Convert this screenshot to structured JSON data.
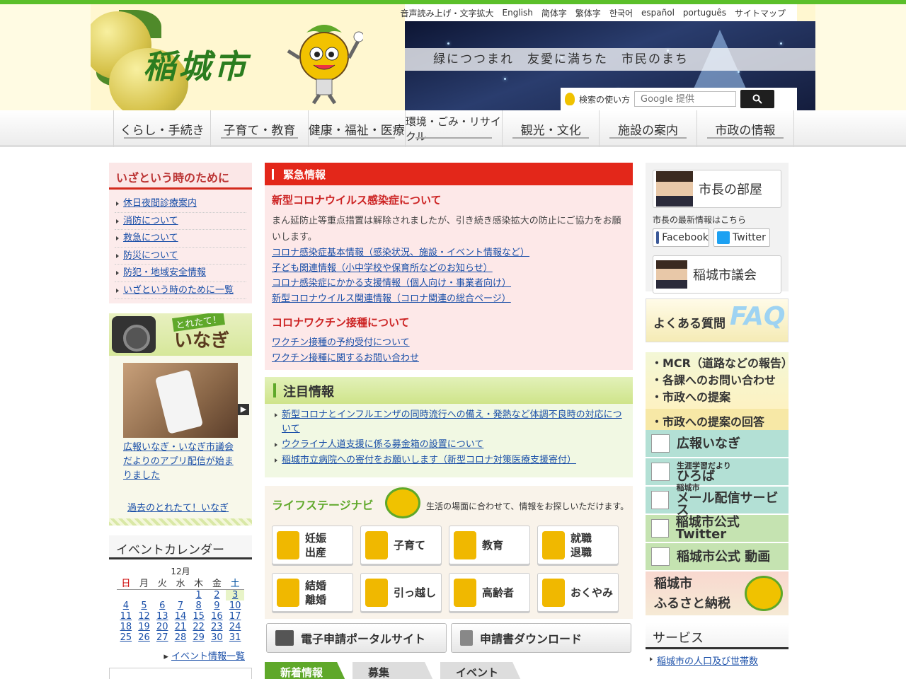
{
  "header": {
    "city_logo": "稲城市",
    "slogan": "緑につつまれ　友愛に満ちた　市民のまち",
    "lang_links": [
      "音声読み上げ・文字拡大",
      "English",
      "简体字",
      "繁体字",
      "한국어",
      "español",
      "português",
      "サイトマップ"
    ],
    "search_help": "検索の使い方",
    "search_placeholder": "Google 提供"
  },
  "nav": [
    "くらし・手続き",
    "子育て・教育",
    "健康・福祉・医療",
    "環境・ごみ・リサイクル",
    "観光・文化",
    "施設の案内",
    "市政の情報"
  ],
  "emergency_side": {
    "title": "いざという時のために",
    "links": [
      "休日夜間診療案内",
      "消防について",
      "救急について",
      "防災について",
      "防犯・地域安全情報",
      "いざという時のために一覧"
    ]
  },
  "toretate": {
    "sub": "とれたて！",
    "title": "いなぎ",
    "caption": "広報いなぎ・いなぎ市議会だよりのアプリ配信が始まりました",
    "past_link": "過去のとれたて！いなぎ"
  },
  "calendar": {
    "title": "イベントカレンダー",
    "month": "12月",
    "weekdays": [
      "日",
      "月",
      "火",
      "水",
      "木",
      "金",
      "土"
    ],
    "weeks": [
      [
        "",
        "",
        "",
        "",
        "1",
        "2",
        "3"
      ],
      [
        "4",
        "5",
        "6",
        "7",
        "8",
        "9",
        "10"
      ],
      [
        "11",
        "12",
        "13",
        "14",
        "15",
        "16",
        "17"
      ],
      [
        "18",
        "19",
        "20",
        "21",
        "22",
        "23",
        "24"
      ],
      [
        "25",
        "26",
        "27",
        "28",
        "29",
        "30",
        "31"
      ]
    ],
    "event_link": "イベント情報一覧"
  },
  "emergency": {
    "header": "緊急情報",
    "corona_title": "新型コロナウイルス感染症について",
    "corona_text": "まん延防止等重点措置は解除されましたが、引き続き感染拡大の防止にご協力をお願いします。",
    "corona_links": [
      "コロナ感染症基本情報（感染状況、施設・イベント情報など）",
      "子ども関連情報（小中学校や保育所などのお知らせ）",
      "コロナ感染症にかかる支援情報（個人向け・事業者向け）",
      "新型コロナウイルス関連情報（コロナ関連の総合ページ）"
    ],
    "vaccine_title": "コロナワクチン接種について",
    "vaccine_links": [
      "ワクチン接種の予約受付について",
      "ワクチン接種に関するお問い合わせ"
    ]
  },
  "attention": {
    "header": "注目情報",
    "items": [
      "新型コロナとインフルエンザの同時流行への備え・発熱など体調不良時の対応について",
      "ウクライナ人道支援に係る募金箱の設置について",
      "稲城市立病院への寄付をお願いします（新型コロナ対策医療支援寄付）"
    ]
  },
  "life_stage": {
    "title": "ライフステージナビ",
    "subtitle": "生活の場面に合わせて、情報をお探しいただけます。",
    "buttons": [
      "妊娠\n出産",
      "子育て",
      "教育",
      "就職\n退職",
      "結婚\n離婚",
      "引っ越し",
      "高齢者",
      "おくやみ"
    ]
  },
  "apply": [
    "電子申請ポータルサイト",
    "申請書ダウンロード"
  ],
  "tabs": [
    "新着情報",
    "募集",
    "イベント"
  ],
  "right": {
    "mayor": "市長の部屋",
    "mayor_latest": "市長の最新情報はこちら",
    "facebook": "Facebook",
    "twitter": "Twitter",
    "council": "稲城市議会",
    "faq": "よくある質問",
    "faq_mark": "FAQ",
    "mcr": [
      "・MCR（道路などの報告）",
      "・各課へのお問い合わせ",
      "・市政への提案"
    ],
    "proposal_answer": "・市政への提案の回答",
    "koho": "広報いなぎ",
    "hiroba_small": "生涯学習だより",
    "hiroba": "ひろば",
    "mail_small": "稲城市",
    "mail": "メール配信サービス",
    "twitter_official": "稲城市公式 Twitter",
    "video": "稲城市公式 動画",
    "furusato": "稲城市\nふるさと納税",
    "service": "サービス",
    "population": "稲城市の人口及び世帯数"
  }
}
